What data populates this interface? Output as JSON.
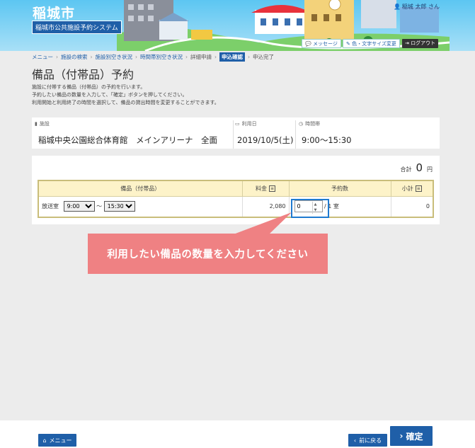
{
  "header": {
    "city": "稲城市",
    "system": "稲城市公共施設予約システム",
    "user": "稲城 太郎 さん",
    "message_btn": "メッセージ",
    "color_btn": "色・文字サイズ変更",
    "logout_btn": "ログアウト"
  },
  "breadcrumb": {
    "items": [
      "メニュー",
      "施設の検索",
      "施設別空き状況",
      "時間帯別空き状況",
      "詳細申請",
      "申込確認",
      "申込完了"
    ]
  },
  "page": {
    "title": "備品（付帯品）予約",
    "desc1": "施設に付帯する備品（付帯品）の予約を行います。",
    "desc2": "予約したい備品の数量を入力して、「確定」ボタンを押してください。",
    "desc3": "利用開始と利用終了の時間を選択して、備品の貸出時間を変更することができます。"
  },
  "info": {
    "facility_label": "施設",
    "facility_value": "稲城中央公園総合体育館　メインアリーナ　全面",
    "date_label": "利用日",
    "date_value": "2019/10/5(土)",
    "time_label": "時間帯",
    "time_value": "9:00～15:30"
  },
  "equip": {
    "total_label": "合計",
    "total_value": "0",
    "total_unit": "円",
    "col_item": "備品（付帯品）",
    "col_fee": "料金",
    "col_qty": "予約数",
    "col_subtotal": "小計",
    "row": {
      "name": "放送室",
      "start": "9:00",
      "tilde": "～",
      "end": "15:30",
      "fee": "2,080",
      "qty": "0",
      "max": "/ 1 室",
      "subtotal": "0"
    }
  },
  "callout": {
    "text": "利用したい備品の数量を入力してください"
  },
  "footer": {
    "menu": "メニュー",
    "back": "前に戻る",
    "confirm": "確定"
  }
}
